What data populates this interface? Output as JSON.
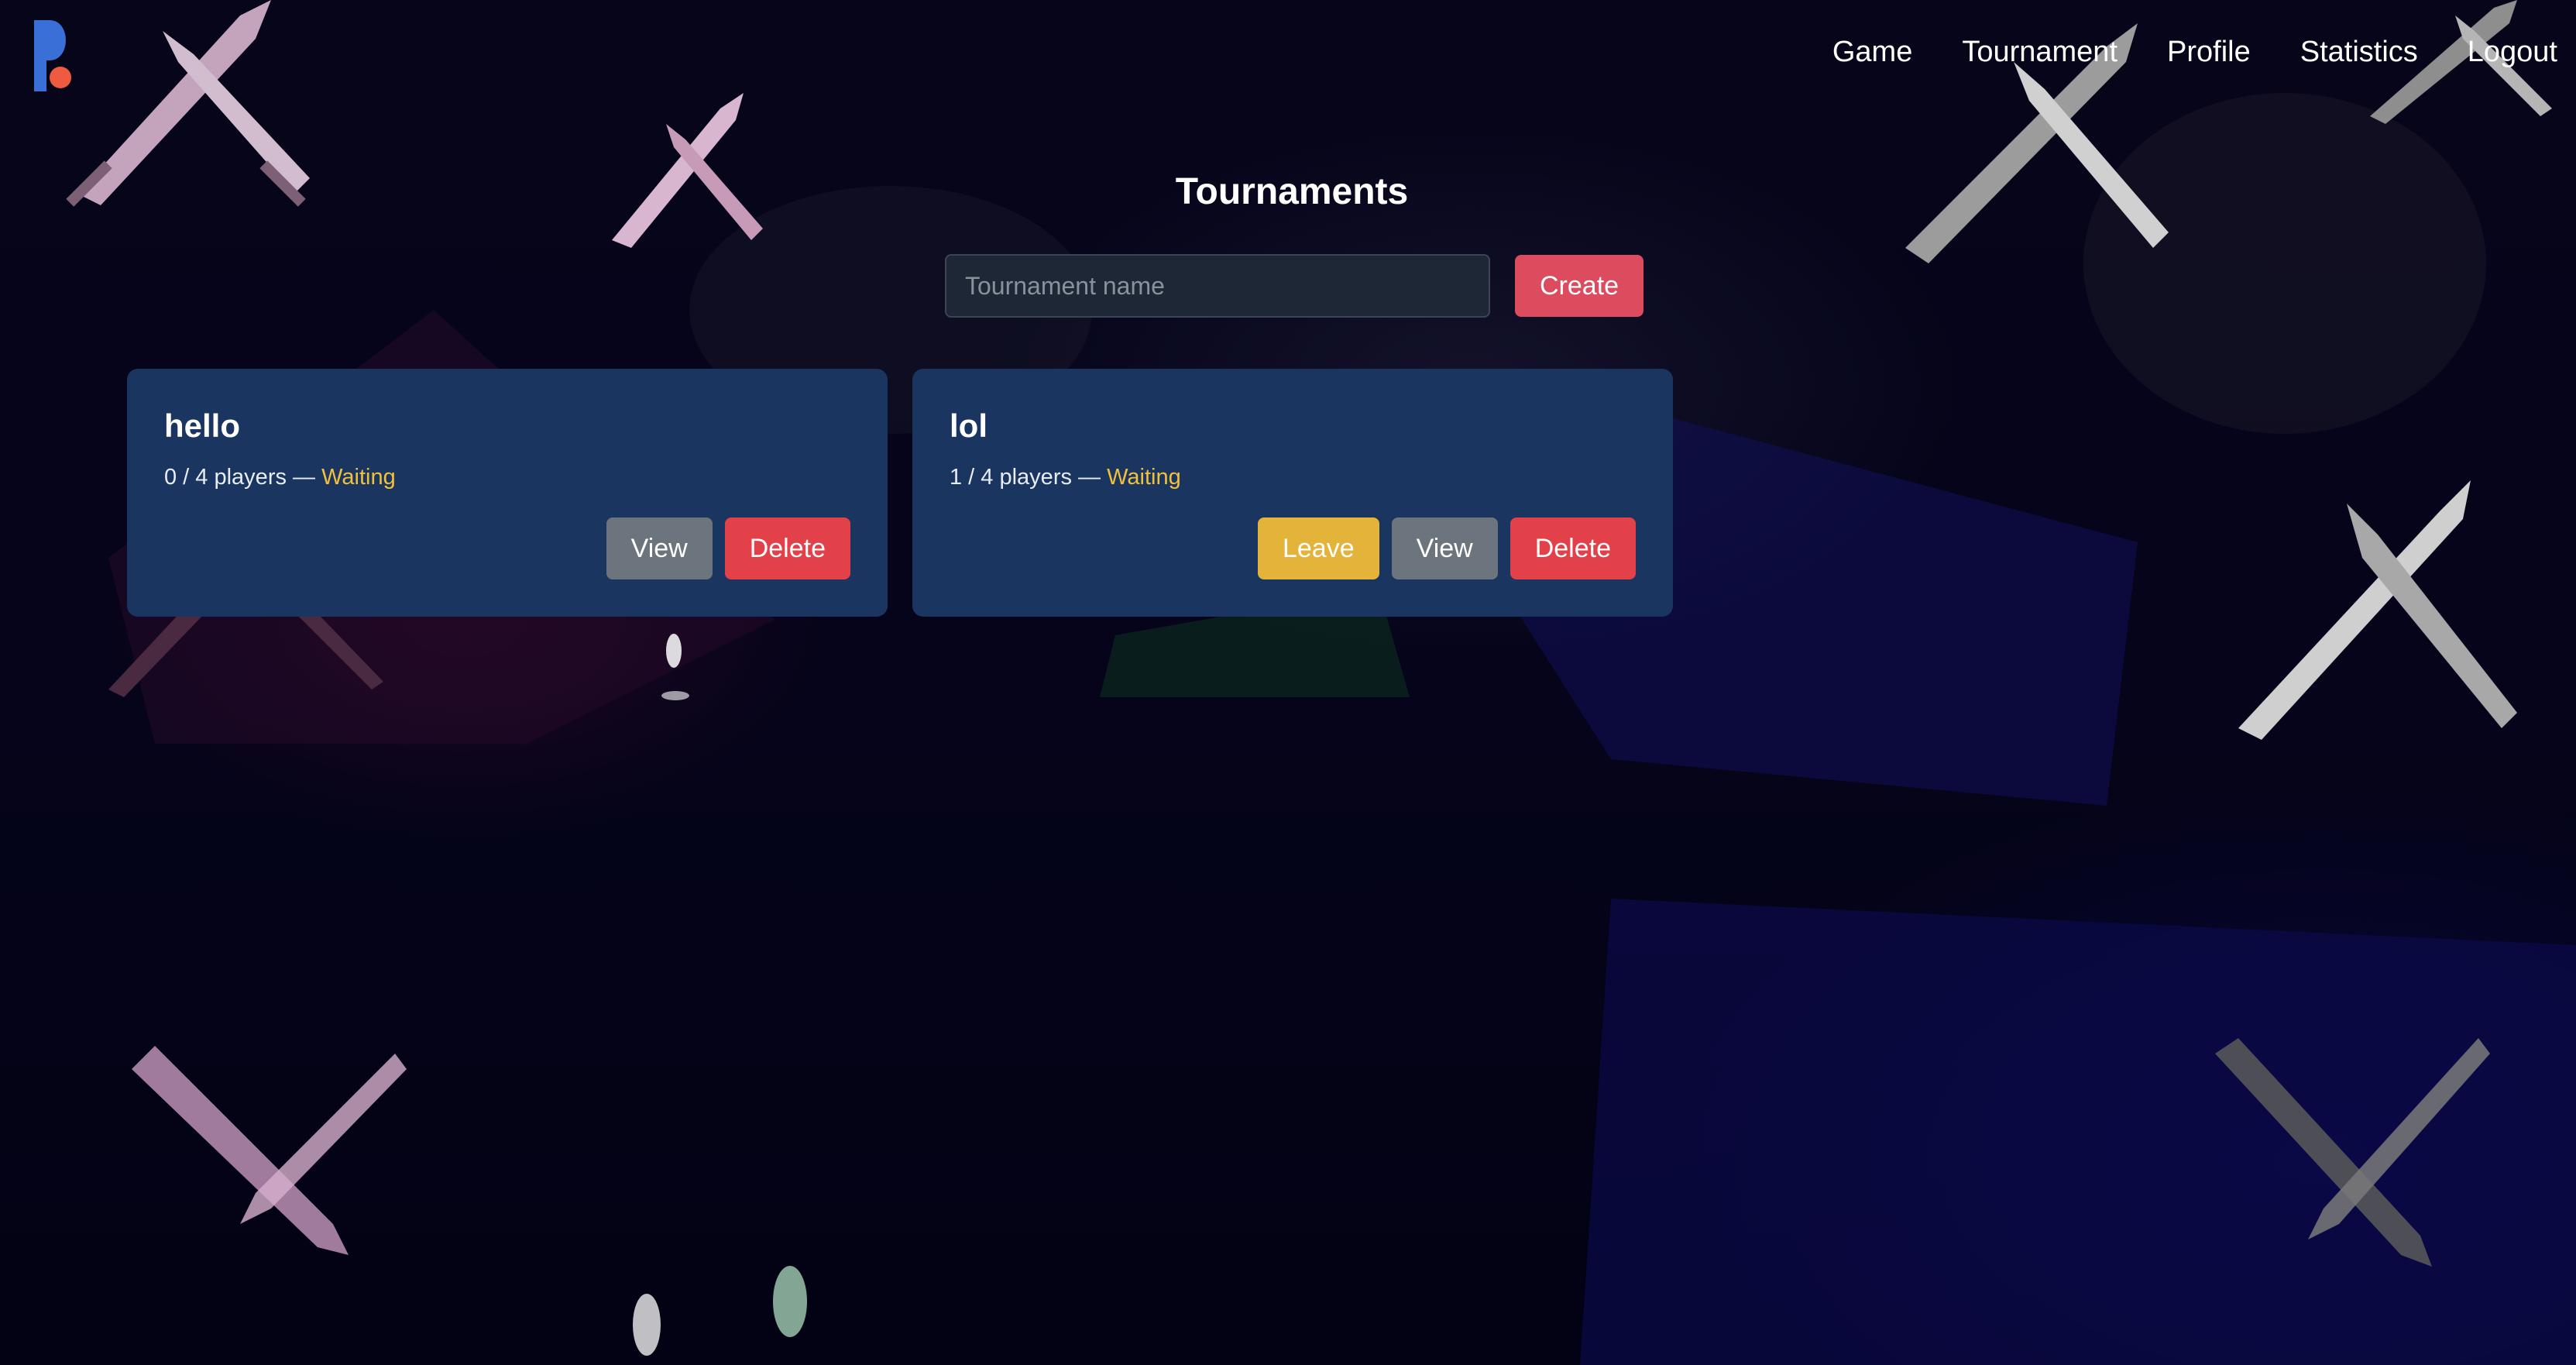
{
  "nav": {
    "items": [
      {
        "label": "Game",
        "name": "nav-game"
      },
      {
        "label": "Tournament",
        "name": "nav-tournament"
      },
      {
        "label": "Profile",
        "name": "nav-profile"
      },
      {
        "label": "Statistics",
        "name": "nav-statistics"
      },
      {
        "label": "Logout",
        "name": "nav-logout"
      }
    ]
  },
  "page": {
    "title": "Tournaments"
  },
  "create": {
    "placeholder": "Tournament name",
    "value": "",
    "button_label": "Create"
  },
  "tournaments": [
    {
      "name": "hello",
      "players": "0 / 4 players —",
      "status": "Waiting",
      "actions": {
        "view": "View",
        "delete": "Delete"
      }
    },
    {
      "name": "lol",
      "players": "1 / 4 players —",
      "status": "Waiting",
      "actions": {
        "leave": "Leave",
        "view": "View",
        "delete": "Delete"
      }
    }
  ],
  "colors": {
    "background": "#07061a",
    "card": "#1b3561",
    "create_button": "#dc4c5e",
    "view_button": "#6c757d",
    "delete_button": "#e2414a",
    "leave_button": "#e4b33a",
    "status_waiting": "#f2c13b",
    "logo_blue": "#3b6fd8",
    "logo_orange": "#ef5b3f"
  },
  "icons": {
    "logo": "app-logo",
    "background_decoration": "crossed-swords-icon"
  }
}
